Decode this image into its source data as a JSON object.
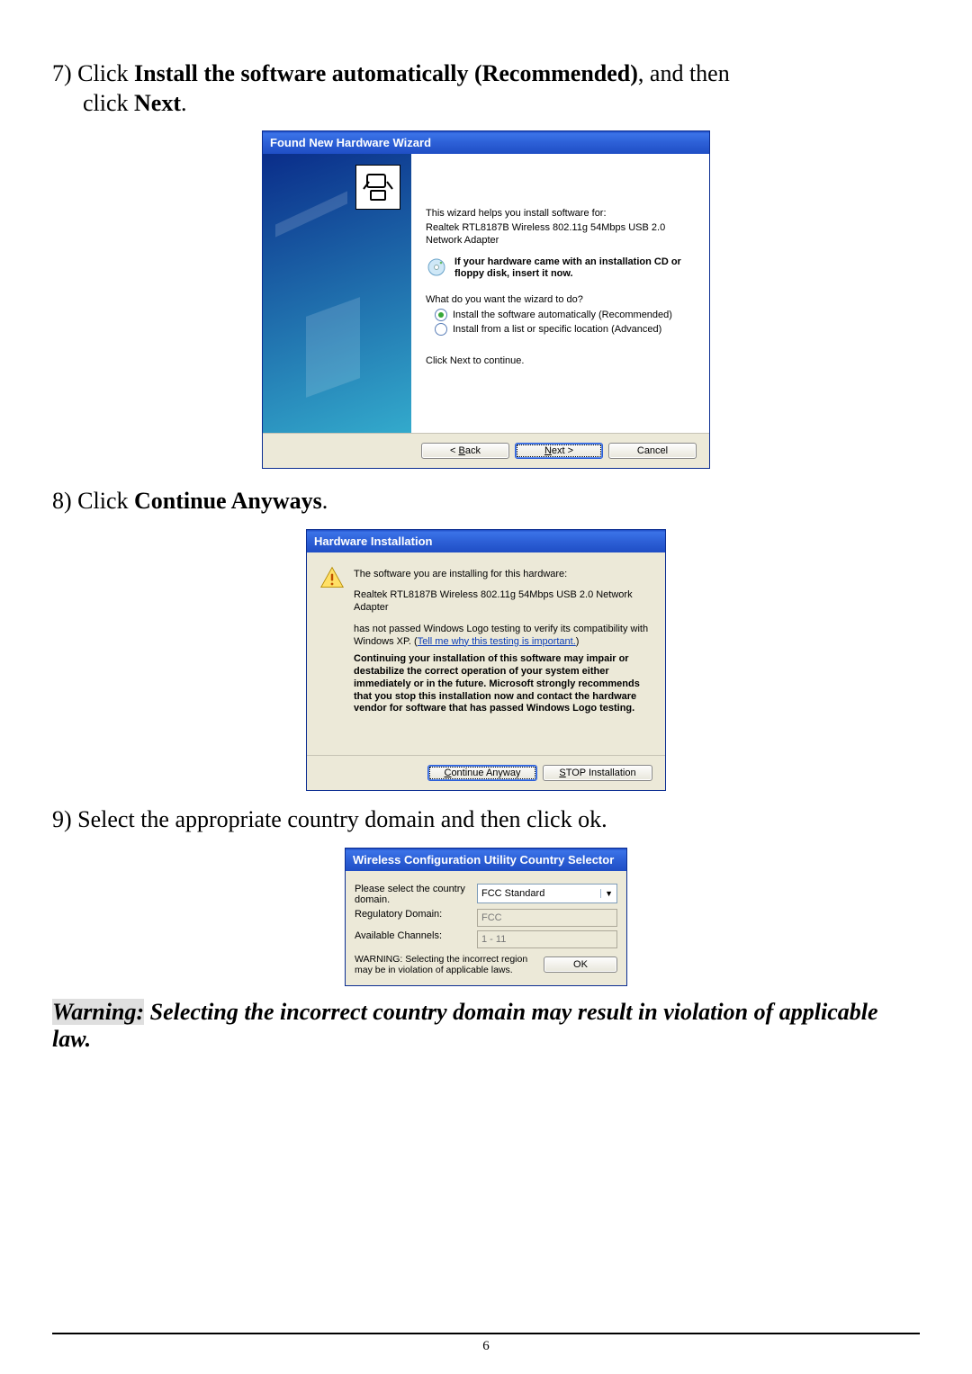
{
  "instr7": {
    "num": "7)",
    "pre": " Click ",
    "bold1": "Install the software automatically (Recommended)",
    "mid": ", and then",
    "line2a": "click ",
    "bold2": "Next",
    "line2b": "."
  },
  "instr8": {
    "num": "8)",
    "pre": " Click ",
    "bold": "Continue Anyways",
    "post": "."
  },
  "instr9": {
    "num": "9)",
    "text": " Select the appropriate country domain and then click ok."
  },
  "warning": {
    "hl_label": "Warning:",
    "rest": " Selecting the incorrect country domain may result in violation of applicable law."
  },
  "page_number": "6",
  "wizard1": {
    "title": "Found New Hardware Wizard",
    "intro": "This wizard helps you install software for:",
    "device": "Realtek RTL8187B Wireless 802.11g 54Mbps USB 2.0 Network Adapter",
    "cd_hint": "If your hardware came with an installation CD or floppy disk, insert it now.",
    "question": "What do you want the wizard to do?",
    "opt_auto": "Install the software automatically (Recommended)",
    "opt_adv": "Install from a list or specific location (Advanced)",
    "click_next": "Click Next to continue.",
    "btn_back_pre": "< ",
    "btn_back_u": "B",
    "btn_back_post": "ack",
    "btn_next_u": "N",
    "btn_next_post": "ext >",
    "btn_cancel": "Cancel"
  },
  "dialog2": {
    "title": "Hardware Installation",
    "line1": "The software you are installing for this hardware:",
    "device": "Realtek RTL8187B Wireless 802.11g 54Mbps USB 2.0 Network Adapter",
    "line2a": "has not passed Windows Logo testing to verify its compatibility with Windows XP. (",
    "link": "Tell me why this testing is important.",
    "line2b": ")",
    "strong": "Continuing your installation of this software may impair or destabilize the correct operation of your system either immediately or in the future. Microsoft strongly recommends that you stop this installation now and contact the hardware vendor for software that has passed Windows Logo testing.",
    "btn_continue_u": "C",
    "btn_continue_post": "ontinue Anyway",
    "btn_stop_u": "S",
    "btn_stop_post": "TOP Installation"
  },
  "dialog3": {
    "title": "Wireless Configuration Utility Country Selector",
    "label_country": "Please select the country domain.",
    "sel_value": "FCC Standard",
    "label_reg": "Regulatory Domain:",
    "reg_value": "FCC",
    "label_chan": "Available Channels:",
    "chan_value": "1 - 11",
    "warn": "WARNING: Selecting the incorrect region may be in violation of applicable laws.",
    "btn_ok": "OK"
  }
}
